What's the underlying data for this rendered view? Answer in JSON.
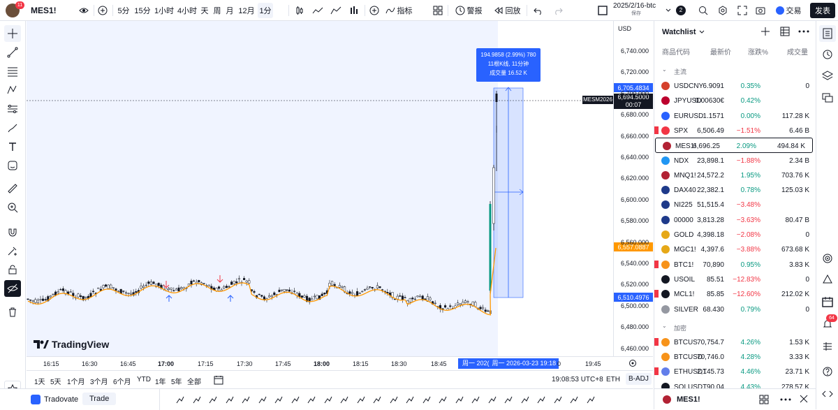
{
  "topbar": {
    "symbol": "MES1!",
    "avatar_badge": "11",
    "timeframes": [
      "5分",
      "15分",
      "1小时",
      "4小时",
      "天",
      "周",
      "月",
      "12月",
      "1分"
    ],
    "indicators": "指标",
    "alert": "警报",
    "replay": "回放",
    "layout_name": "2025/2/16-btc",
    "layout_sub": "保存",
    "layout_badge": "2",
    "trade": "交易",
    "publish": "发表"
  },
  "chart": {
    "current_symbol_tag": "MESM2026",
    "watermark": "TradingView",
    "tooltip": {
      "line1": "194.9858 (2.99%) 780",
      "line2": "11根K线, 11分钟",
      "line3": "成交量 16.52 K"
    },
    "time_label_a": "周一 202(",
    "time_label_b": "周一 2026-03-23 19:18",
    "time_label_c": "0",
    "colors": {
      "up": "#089981",
      "down": "#f23645",
      "ma": "#ff9800",
      "selection": "#2962ff"
    }
  },
  "yaxis": {
    "currency": "USD",
    "ticks": [
      "6,740.000",
      "6,720.000",
      "6,700.000",
      "6,680.000",
      "6,660.000",
      "6,640.000",
      "6,620.000",
      "6,600.000",
      "6,580.000",
      "6,560.000",
      "6,540.000",
      "6,520.000",
      "6,500.000",
      "6,480.000",
      "6,460.000"
    ],
    "label_top": "6,705.4834",
    "label_price": "6,694.5000",
    "label_countdown": "00:07",
    "label_ma": "6,557.0887",
    "label_bottom": "6,510.4976"
  },
  "xaxis": {
    "ticks": [
      "16:15",
      "16:30",
      "16:45",
      "17:00",
      "17:15",
      "17:30",
      "17:45",
      "18:00",
      "18:15",
      "18:30",
      "18:45",
      "19:45"
    ]
  },
  "bottombar": {
    "ranges": [
      "1天",
      "5天",
      "1个月",
      "3个月",
      "6个月",
      "YTD",
      "1年",
      "5年",
      "全部"
    ],
    "clock": "19:08:53 UTC+8",
    "session": "ETH",
    "adj": "B-ADJ"
  },
  "tradebar": {
    "broker": "Tradovate",
    "trade": "Trade"
  },
  "watchlist": {
    "title": "Watchlist",
    "columns": [
      "商品代码",
      "最新价",
      "涨跌%",
      "成交量"
    ],
    "sections": [
      {
        "name": "主流",
        "rows": [
          {
            "sym": "USDCNY",
            "last": "6.9091",
            "chg": "0.35%",
            "vol": "0",
            "dir": "up",
            "flag": false,
            "color": "#d5402b"
          },
          {
            "sym": "JPYUSD",
            "last": "0.00630€",
            "chg": "0.42%",
            "vol": "",
            "dir": "up",
            "flag": false,
            "color": "#bc002d"
          },
          {
            "sym": "EURUSD",
            "last": "1.1571",
            "chg": "0.00%",
            "vol": "117.28 K",
            "dir": "up",
            "flag": false,
            "color": "#2962ff"
          },
          {
            "sym": "SPX",
            "last": "6,506.49",
            "chg": "−1.51%",
            "vol": "6.46 B",
            "dir": "dn",
            "flag": true,
            "color": "#f23645"
          },
          {
            "sym": "MES1!",
            "last": "6,696.25",
            "chg": "2.09%",
            "vol": "494.84 K",
            "dir": "up",
            "flag": false,
            "color": "#b22234",
            "selected": true
          },
          {
            "sym": "NDX",
            "last": "23,898.1",
            "chg": "−1.88%",
            "vol": "2.34 B",
            "dir": "dn",
            "flag": false,
            "color": "#2196f3"
          },
          {
            "sym": "MNQ1!",
            "last": "24,572.2",
            "chg": "1.95%",
            "vol": "703.76 K",
            "dir": "up",
            "flag": false,
            "color": "#b22234"
          },
          {
            "sym": "DAX40",
            "last": "22,382.1",
            "chg": "0.78%",
            "vol": "125.03 K",
            "dir": "up",
            "flag": false,
            "color": "#1e3a8a"
          },
          {
            "sym": "NI225",
            "last": "51,515.4",
            "chg": "−3.48%",
            "vol": "",
            "dir": "dn",
            "flag": false,
            "color": "#1e3a8a"
          },
          {
            "sym": "00000",
            "last": "3,813.28",
            "chg": "−3.63%",
            "vol": "80.47 B",
            "dir": "dn",
            "flag": false,
            "color": "#1e3a8a"
          },
          {
            "sym": "GOLD",
            "last": "4,398.18",
            "chg": "−2.08%",
            "vol": "0",
            "dir": "dn",
            "flag": false,
            "color": "#e6a817"
          },
          {
            "sym": "MGC1!",
            "last": "4,397.6",
            "chg": "−3.88%",
            "vol": "673.68 K",
            "dir": "dn",
            "flag": false,
            "color": "#e6a817"
          },
          {
            "sym": "BTC1!",
            "last": "70,890",
            "chg": "0.95%",
            "vol": "3.83 K",
            "dir": "up",
            "flag": true,
            "color": "#f7931a"
          },
          {
            "sym": "USOIL",
            "last": "85.51",
            "chg": "−12.83%",
            "vol": "0",
            "dir": "dn",
            "flag": false,
            "color": "#131722"
          },
          {
            "sym": "MCL1!",
            "last": "85.85",
            "chg": "−12.60%",
            "vol": "212.02 K",
            "dir": "dn",
            "flag": true,
            "color": "#131722"
          },
          {
            "sym": "SILVER",
            "last": "68.430",
            "chg": "0.79%",
            "vol": "0",
            "dir": "up",
            "flag": false,
            "color": "#9598a1"
          }
        ]
      },
      {
        "name": "加密",
        "rows": [
          {
            "sym": "BTCUS",
            "last": "70,754.7",
            "chg": "4.26%",
            "vol": "1.53 K",
            "dir": "up",
            "flag": true,
            "color": "#f7931a"
          },
          {
            "sym": "BTCUSD",
            "last": "70,746.0",
            "chg": "4.28%",
            "vol": "3.33 K",
            "dir": "up",
            "flag": false,
            "color": "#f7931a"
          },
          {
            "sym": "ETHUSDT",
            "last": "2,145.73",
            "chg": "4.46%",
            "vol": "23.71 K",
            "dir": "up",
            "flag": true,
            "color": "#627eea"
          },
          {
            "sym": "SOLUSDT",
            "last": "90.04",
            "chg": "4.43%",
            "vol": "278.57 K",
            "dir": "up",
            "flag": false,
            "color": "#131722"
          }
        ]
      }
    ]
  },
  "symbol_bar": {
    "symbol": "MES1!"
  },
  "right_badge": "64"
}
